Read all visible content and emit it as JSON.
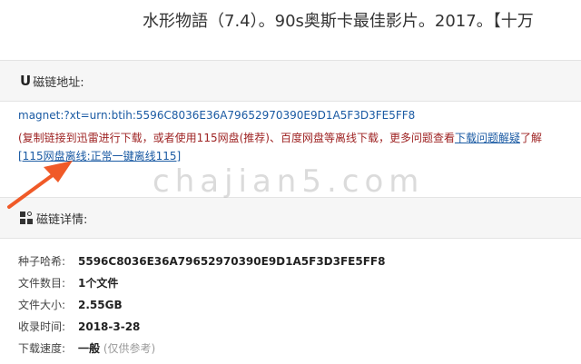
{
  "title": "水形物語（7.4）。90s奥斯卡最佳影片。2017。【十万",
  "magnet_panel": {
    "heading_icon": "U",
    "heading": "磁链地址:",
    "link": "magnet:?xt=urn:btih:5596C8036E36A79652970390E9D1A5F3D3FE5FF8",
    "tip_prefix": "(复制链接到迅雷进行下载，或者使用115网盘(推荐)、百度网盘等离线下载，更多问题查看",
    "tip_link": "下载问题解疑",
    "tip_suffix": "了解",
    "offline_link": "[115网盘离线:正常一键离线115]"
  },
  "details_panel": {
    "heading": "磁链详情:",
    "rows": [
      {
        "label": "种子哈希:",
        "value": "5596C8036E36A79652970390E9D1A5F3D3FE5FF8"
      },
      {
        "label": "文件数目:",
        "value": "1个文件"
      },
      {
        "label": "文件大小:",
        "value": "2.55GB"
      },
      {
        "label": "收录时间:",
        "value": "2018-3-28"
      },
      {
        "label": "下载速度:",
        "value": "一般",
        "note": "(仅供参考)"
      }
    ]
  },
  "watermark": "chajian5.com",
  "colors": {
    "arrow": "#f05a28",
    "link": "#1a5aa3",
    "tip": "#9e2323"
  }
}
